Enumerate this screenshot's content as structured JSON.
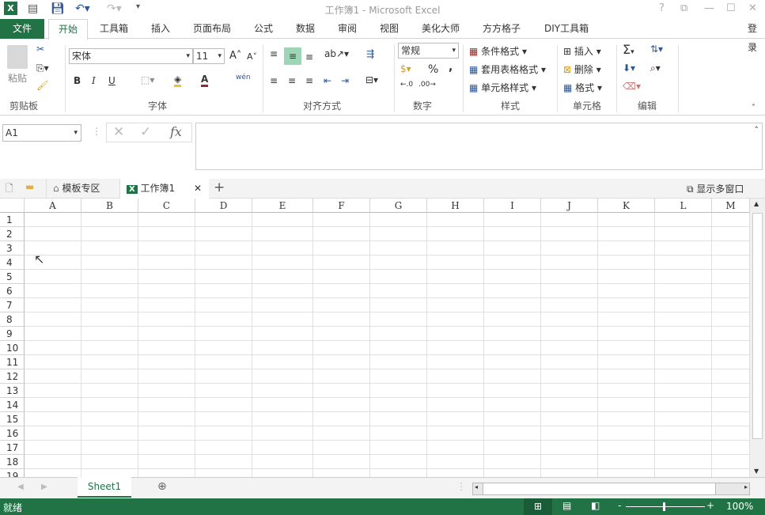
{
  "title": "工作簿1 - Microsoft Excel",
  "window": {
    "help": "?",
    "restore_ribbon": "⧉",
    "minimize": "—",
    "maximize": "☐",
    "close": "✕"
  },
  "tabs": {
    "file": "文件",
    "items": [
      "开始",
      "工具箱",
      "插入",
      "页面布局",
      "公式",
      "数据",
      "审阅",
      "视图",
      "美化大师",
      "方方格子",
      "DIY工具箱"
    ],
    "login": "登录"
  },
  "ribbon": {
    "clipboard": {
      "paste": "粘贴",
      "label": "剪贴板"
    },
    "font": {
      "name": "宋体",
      "size": "11",
      "label": "字体",
      "bold": "B",
      "italic": "I",
      "underline": "U",
      "phonetic": "wén"
    },
    "alignment": {
      "label": "对齐方式"
    },
    "number": {
      "format": "常规",
      "percent": "%",
      "comma": ",",
      "label": "数字"
    },
    "styles": {
      "conditional": "条件格式",
      "table": "套用表格格式",
      "cell": "单元格样式",
      "label": "样式"
    },
    "cells": {
      "insert": "插入",
      "delete": "删除",
      "format": "格式",
      "label": "单元格"
    },
    "editing": {
      "label": "编辑"
    }
  },
  "formula_bar": {
    "name_box": "A1",
    "fx": "fx",
    "value": ""
  },
  "doc_tabs": {
    "template": "模板专区",
    "workbook": "工作簿1",
    "multi_window": "显示多窗口"
  },
  "columns": [
    "A",
    "B",
    "C",
    "D",
    "E",
    "F",
    "G",
    "H",
    "I",
    "J",
    "K",
    "L",
    "M"
  ],
  "rows": [
    "1",
    "2",
    "3",
    "4",
    "5",
    "6",
    "7",
    "8",
    "9",
    "10",
    "11",
    "12",
    "13",
    "14",
    "15",
    "16",
    "17",
    "18",
    "19"
  ],
  "sheets": [
    "Sheet1"
  ],
  "status": {
    "ready": "就绪",
    "zoom": "100%"
  },
  "colors": {
    "accent": "#217346"
  }
}
